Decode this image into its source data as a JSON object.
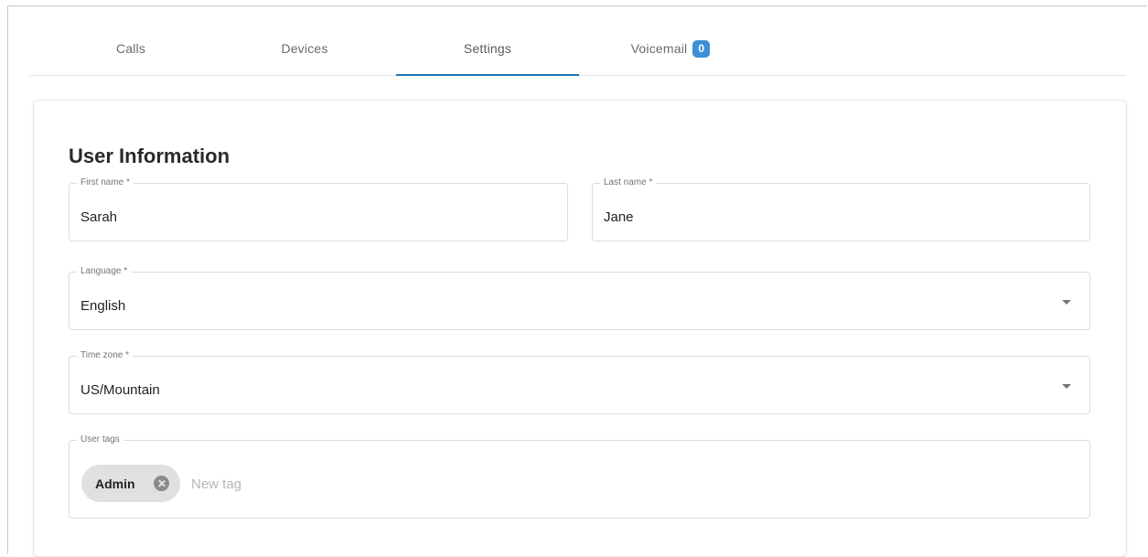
{
  "tabs": [
    {
      "label": "Calls"
    },
    {
      "label": "Devices"
    },
    {
      "label": "Settings",
      "active": true
    },
    {
      "label": "Voicemail",
      "badge": "0"
    }
  ],
  "section_title": "User Information",
  "fields": {
    "first_name": {
      "label": "First name *",
      "value": "Sarah"
    },
    "last_name": {
      "label": "Last name *",
      "value": "Jane"
    },
    "language": {
      "label": "Language *",
      "value": "English"
    },
    "time_zone": {
      "label": "Time zone *",
      "value": "US/Mountain"
    },
    "user_tags": {
      "label": "User tags",
      "tags": [
        {
          "label": "Admin"
        }
      ],
      "placeholder": "New tag"
    }
  },
  "icons": {
    "dropdown": "chevron-down-icon",
    "remove_tag": "close-circle-icon"
  },
  "colors": {
    "accent": "#1f77b4",
    "badge": "#3e8fd6",
    "chip": "#e0e0e0"
  }
}
